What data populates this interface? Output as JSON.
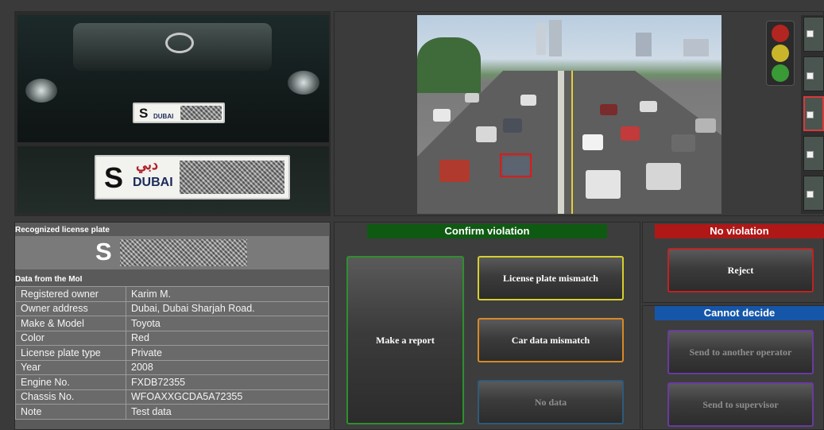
{
  "camera": {
    "plate_prefix": "S",
    "plate_city": "DUBAI",
    "plate_arabic": "دبي"
  },
  "traffic_light": {
    "colors": [
      "#b32520",
      "#c9b52a",
      "#3a9a35"
    ]
  },
  "recognized": {
    "header": "Recognized license plate",
    "plate_prefix": "S"
  },
  "moi": {
    "header": "Data from the MoI",
    "rows": [
      {
        "label": "Registered owner",
        "value": "Karim M."
      },
      {
        "label": "Owner address",
        "value": "Dubai, Dubai Sharjah Road."
      },
      {
        "label": "Make & Model",
        "value": "Toyota"
      },
      {
        "label": "Color",
        "value": "Red"
      },
      {
        "label": "License plate type",
        "value": "Private"
      },
      {
        "label": "Year",
        "value": "2008"
      },
      {
        "label": "Engine No.",
        "value": "FXDB72355"
      },
      {
        "label": "Chassis No.",
        "value": "WFOAXXGCDA5A72355"
      },
      {
        "label": "Note",
        "value": "Test data"
      }
    ]
  },
  "confirm": {
    "header": "Confirm violation",
    "header_color": "#0f5a12",
    "make_report": "Make a report",
    "plate_mismatch": "License plate mismatch",
    "car_data_mismatch": "Car data mismatch",
    "no_data": "No data"
  },
  "no_violation": {
    "header": "No violation",
    "header_color": "#b01818",
    "reject": "Reject"
  },
  "cannot_decide": {
    "header": "Cannot decide",
    "header_color": "#1656a8",
    "send_operator": "Send to another operator",
    "send_supervisor": "Send to supervisor"
  }
}
